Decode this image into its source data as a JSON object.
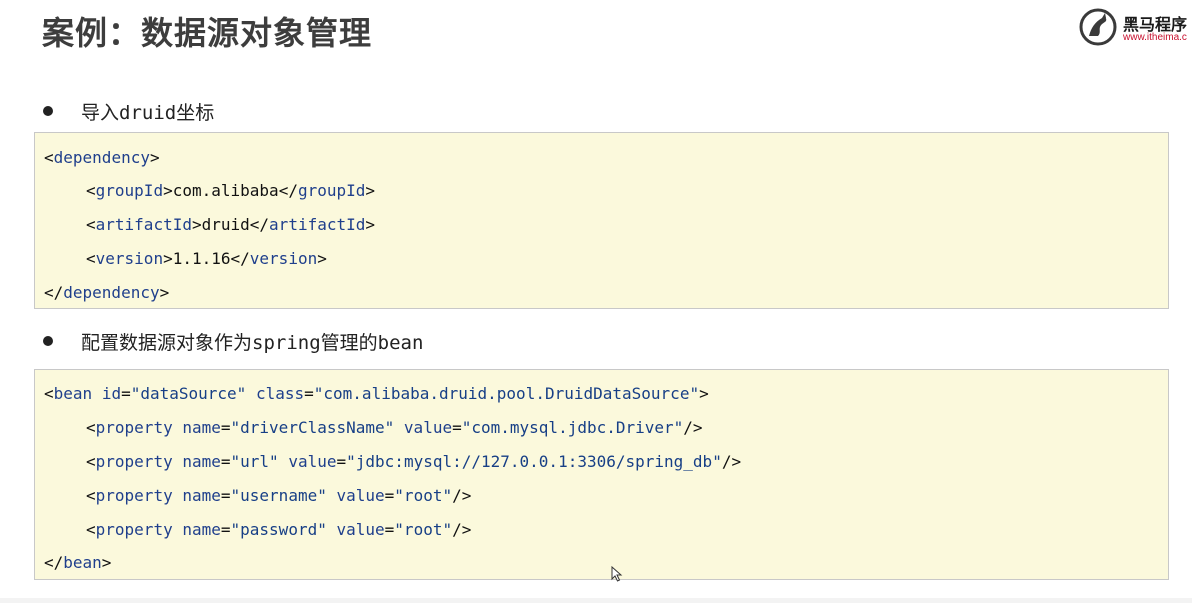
{
  "slide": {
    "title": "案例：数据源对象管理"
  },
  "logo": {
    "name": "黑马程序",
    "url": "www.itheima.c"
  },
  "section1": {
    "bullet": "导入druid坐标",
    "code": {
      "dependency_tag": "dependency",
      "group_tag": "groupId",
      "group_value": "com.alibaba",
      "artifact_tag": "artifactId",
      "artifact_value": "druid",
      "version_tag": "version",
      "version_value": "1.1.16"
    }
  },
  "section2": {
    "bullet": "配置数据源对象作为spring管理的bean",
    "code": {
      "bean_tag": "bean",
      "bean_id_attr": "id",
      "bean_id_value": "\"dataSource\"",
      "bean_class_attr": "class",
      "bean_class_value": "\"com.alibaba.druid.pool.DruidDataSource\"",
      "property_tag": "property",
      "name_attr": "name",
      "value_attr": "value",
      "properties": [
        {
          "name": "\"driverClassName\"",
          "value": "\"com.mysql.jdbc.Driver\""
        },
        {
          "name": "\"url\"",
          "value": "\"jdbc:mysql://127.0.0.1:3306/spring_db\""
        },
        {
          "name": "\"username\"",
          "value": "\"root\""
        },
        {
          "name": "\"password\"",
          "value": "\"root\""
        }
      ]
    }
  }
}
